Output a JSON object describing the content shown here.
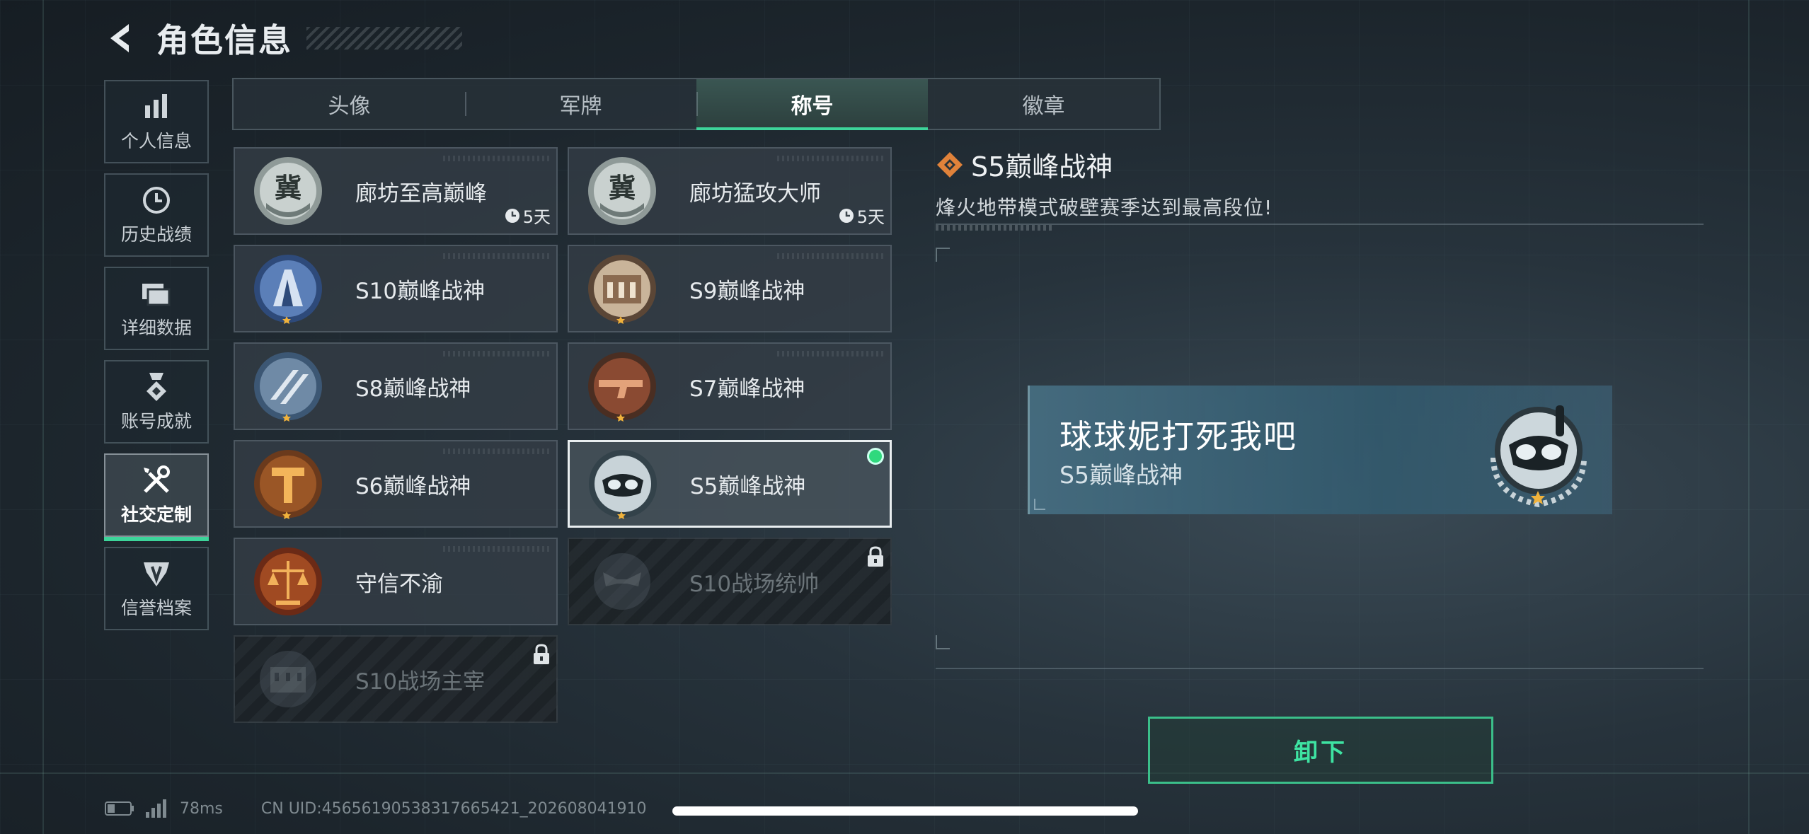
{
  "header": {
    "title": "角色信息"
  },
  "side_nav": [
    {
      "label": "个人信息",
      "icon": "bar-chart-icon",
      "active": false
    },
    {
      "label": "历史战绩",
      "icon": "clock-icon",
      "active": false
    },
    {
      "label": "详细数据",
      "icon": "folder-icon",
      "active": false
    },
    {
      "label": "账号成就",
      "icon": "medal-icon",
      "active": false
    },
    {
      "label": "社交定制",
      "icon": "wrench-screwdriver-icon",
      "active": true
    },
    {
      "label": "信誉档案",
      "icon": "shield-badge-icon",
      "active": false
    }
  ],
  "tabs": [
    {
      "label": "头像",
      "active": false
    },
    {
      "label": "军牌",
      "active": false
    },
    {
      "label": "称号",
      "active": true
    },
    {
      "label": "徽章",
      "active": false
    }
  ],
  "titles": [
    {
      "name": "廊坊至高巅峰",
      "timer": "5天",
      "emblem": "silver-crest-emblem",
      "state": "normal"
    },
    {
      "name": "廊坊猛攻大师",
      "timer": "5天",
      "emblem": "silver-crest-emblem",
      "state": "normal"
    },
    {
      "name": "S10巅峰战神",
      "emblem": "blue-tower-emblem",
      "state": "normal"
    },
    {
      "name": "S9巅峰战神",
      "emblem": "bronze-building-emblem",
      "state": "normal"
    },
    {
      "name": "S8巅峰战神",
      "emblem": "blue-stripes-emblem",
      "state": "normal"
    },
    {
      "name": "S7巅峰战神",
      "emblem": "copper-gun-emblem",
      "state": "normal"
    },
    {
      "name": "S6巅峰战神",
      "emblem": "orange-t-emblem",
      "state": "normal"
    },
    {
      "name": "S5巅峰战神",
      "emblem": "diver-mask-emblem",
      "state": "selected"
    },
    {
      "name": "守信不渝",
      "emblem": "scales-emblem",
      "state": "normal"
    },
    {
      "name": "S10战场统帅",
      "emblem": "drone-emblem",
      "state": "locked"
    },
    {
      "name": "S10战场主宰",
      "emblem": "colosseum-emblem",
      "state": "locked"
    }
  ],
  "detail": {
    "title": "S5巅峰战神",
    "description": "烽火地带模式破壁赛季达到最高段位!",
    "name_card": {
      "player_name": "球球妮打死我吧",
      "title": "S5巅峰战神"
    },
    "unequip_label": "卸下"
  },
  "status": {
    "ping": "78ms",
    "uid": "CN UID:45656190538317665421_202608041910"
  },
  "colors": {
    "accent": "#3dd49a",
    "equipped_dot": "#2fd97d",
    "name_card_bg": "#4a7288"
  }
}
